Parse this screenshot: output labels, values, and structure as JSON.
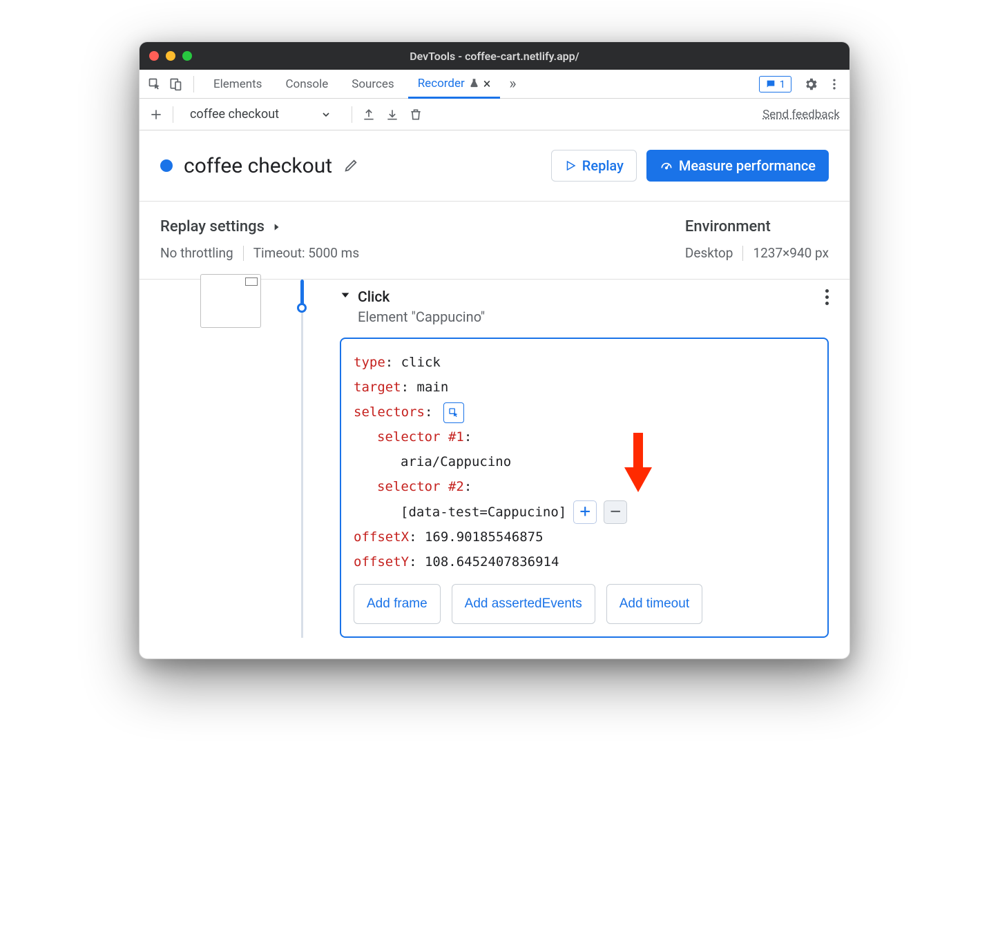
{
  "window": {
    "title": "DevTools - coffee-cart.netlify.app/"
  },
  "tabs": {
    "items": [
      "Elements",
      "Console",
      "Sources",
      "Recorder"
    ],
    "active": "Recorder",
    "feedback_count": "1"
  },
  "toolbar": {
    "recording_name": "coffee checkout",
    "feedback_link": "Send feedback"
  },
  "header": {
    "title": "coffee checkout",
    "replay_label": "Replay",
    "measure_label": "Measure performance"
  },
  "settings": {
    "replay_title": "Replay settings",
    "throttling": "No throttling",
    "timeout": "Timeout: 5000 ms",
    "env_title": "Environment",
    "device": "Desktop",
    "dimensions": "1237×940 px"
  },
  "step": {
    "action": "Click",
    "subtitle": "Element \"Cappucino\"",
    "type_key": "type",
    "type_val": "click",
    "target_key": "target",
    "target_val": "main",
    "selectors_key": "selectors",
    "sel1_label": "selector #1",
    "sel1_val": "aria/Cappucino",
    "sel2_label": "selector #2",
    "sel2_val": "[data-test=Cappucino]",
    "offsetx_key": "offsetX",
    "offsetx_val": "169.90185546875",
    "offsety_key": "offsetY",
    "offsety_val": "108.6452407836914",
    "add_frame": "Add frame",
    "add_asserted": "Add assertedEvents",
    "add_timeout": "Add timeout"
  }
}
